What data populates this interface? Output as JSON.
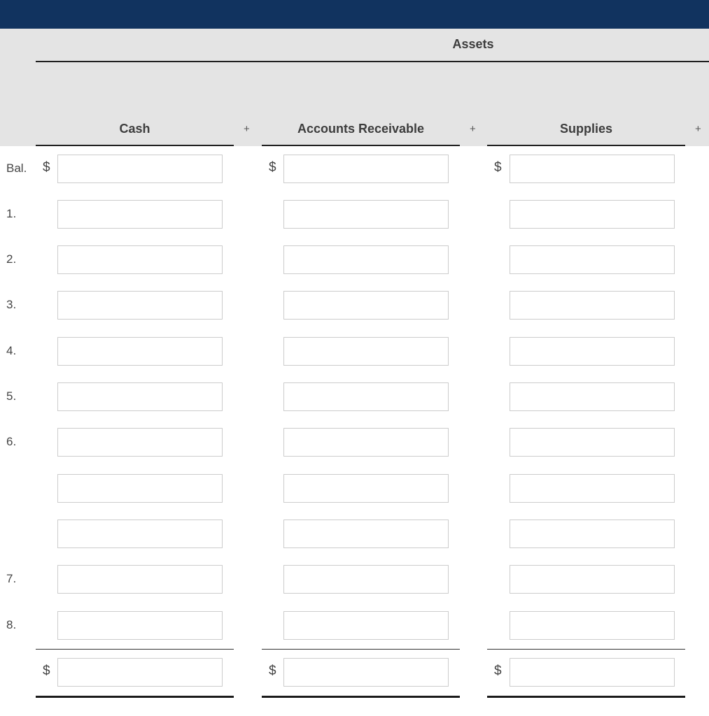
{
  "header": {
    "group_title": "Assets"
  },
  "columns": [
    {
      "label": "Cash",
      "operator": "+"
    },
    {
      "label": "Accounts Receivable",
      "operator": "+"
    },
    {
      "label": "Supplies",
      "operator": "+"
    }
  ],
  "rows": [
    {
      "label": "Bal.",
      "values": [
        "",
        "",
        ""
      ]
    },
    {
      "label": "1.",
      "values": [
        "",
        "",
        ""
      ]
    },
    {
      "label": "2.",
      "values": [
        "",
        "",
        ""
      ]
    },
    {
      "label": "3.",
      "values": [
        "",
        "",
        ""
      ]
    },
    {
      "label": "4.",
      "values": [
        "",
        "",
        ""
      ]
    },
    {
      "label": "5.",
      "values": [
        "",
        "",
        ""
      ]
    },
    {
      "label": "6.",
      "values": [
        "",
        "",
        ""
      ]
    },
    {
      "label": "",
      "values": [
        "",
        "",
        ""
      ]
    },
    {
      "label": "",
      "values": [
        "",
        "",
        ""
      ]
    },
    {
      "label": "7.",
      "values": [
        "",
        "",
        ""
      ]
    },
    {
      "label": "8.",
      "values": [
        "",
        "",
        ""
      ]
    }
  ],
  "totals": {
    "values": [
      "",
      "",
      ""
    ]
  },
  "currency_symbol": "$",
  "colors": {
    "topbar": "#11335f",
    "header_band": "#e4e4e4"
  }
}
